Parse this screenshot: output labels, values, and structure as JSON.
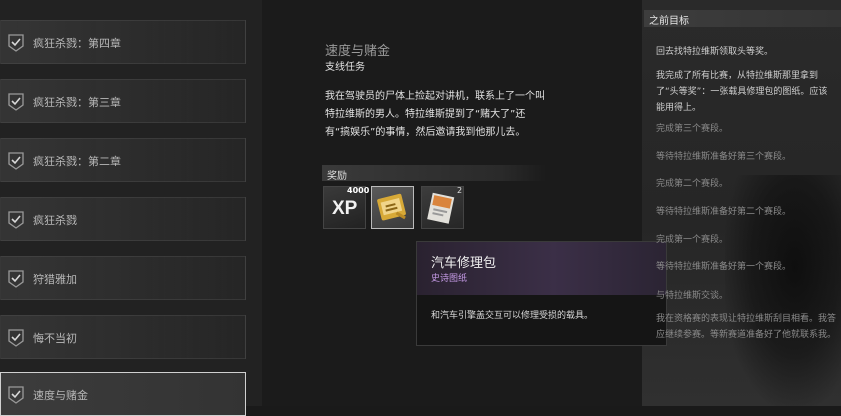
{
  "quest_list": [
    {
      "label": "疯狂杀戮：第四章",
      "completed": true
    },
    {
      "label": "疯狂杀戮：第三章",
      "completed": true
    },
    {
      "label": "疯狂杀戮：第二章",
      "completed": true
    },
    {
      "label": "疯狂杀戮",
      "completed": true
    },
    {
      "label": "狩猎雅加",
      "completed": true
    },
    {
      "label": "悔不当初",
      "completed": true
    },
    {
      "label": "速度与赌金",
      "completed": true,
      "selected": true
    }
  ],
  "quest": {
    "title": "速度与赌金",
    "type": "支线任务",
    "description": "我在驾驶员的尸体上捡起对讲机，联系上了一个叫特拉维斯的男人。特拉维斯提到了“赌大了”还有“搞娱乐”的事情，然后邀请我到他那儿去。"
  },
  "rewards": {
    "label": "奖励",
    "xp_text": "XP",
    "xp_amount": "4000",
    "book_count": "2",
    "items": [
      {
        "icon": "xp-icon"
      },
      {
        "icon": "vehicle-repair-kit-icon"
      },
      {
        "icon": "blueprint-book-icon"
      }
    ]
  },
  "tooltip": {
    "name": "汽车修理包",
    "rarity": "史诗图纸",
    "description": "和汽车引擎盖交互可以修理受损的载具。",
    "rarity_color": "#c59ae6"
  },
  "objectives": {
    "header": "之前目标",
    "items": [
      "回去找特拉维斯领取头等奖。",
      "我完成了所有比赛，从特拉维斯那里拿到了“头等奖”：一张载具修理包的图纸。应该能用得上。",
      "完成第三个赛段。",
      "等待特拉维斯准备好第三个赛段。",
      "完成第二个赛段。",
      "等待特拉维斯准备好第二个赛段。",
      "完成第一个赛段。",
      "等待特拉维斯准备好第一个赛段。",
      "与特拉维斯交谈。",
      "我在资格赛的表现让特拉维斯刮目相看。我答应继续参赛。等新赛道准备好了他就联系我。"
    ]
  }
}
